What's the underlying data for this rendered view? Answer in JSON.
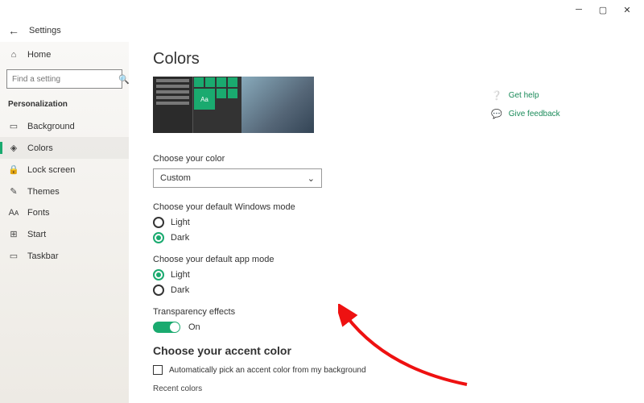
{
  "window": {
    "title": "Settings"
  },
  "sidebar": {
    "home": "Home",
    "search_placeholder": "Find a setting",
    "group": "Personalization",
    "items": [
      {
        "icon": "▭",
        "label": "Background"
      },
      {
        "icon": "◈",
        "label": "Colors"
      },
      {
        "icon": "🔒",
        "label": "Lock screen"
      },
      {
        "icon": "✎",
        "label": "Themes"
      },
      {
        "icon": "Aᴀ",
        "label": "Fonts"
      },
      {
        "icon": "⊞",
        "label": "Start"
      },
      {
        "icon": "▭",
        "label": "Taskbar"
      }
    ],
    "active_index": 1
  },
  "help": {
    "get_help": "Get help",
    "give_feedback": "Give feedback"
  },
  "page": {
    "title": "Colors",
    "preview_tile_text": "Aa",
    "choose_color_label": "Choose your color",
    "choose_color_value": "Custom",
    "windows_mode_label": "Choose your default Windows mode",
    "windows_mode": {
      "light": "Light",
      "dark": "Dark",
      "selected": "dark"
    },
    "app_mode_label": "Choose your default app mode",
    "app_mode": {
      "light": "Light",
      "dark": "Dark",
      "selected": "light"
    },
    "transparency_label": "Transparency effects",
    "transparency_state": "On",
    "accent_heading": "Choose your accent color",
    "auto_accent_label": "Automatically pick an accent color from my background",
    "recent_label": "Recent colors"
  },
  "colors": {
    "accent": "#1aaa6f",
    "arrow": "#e11"
  }
}
